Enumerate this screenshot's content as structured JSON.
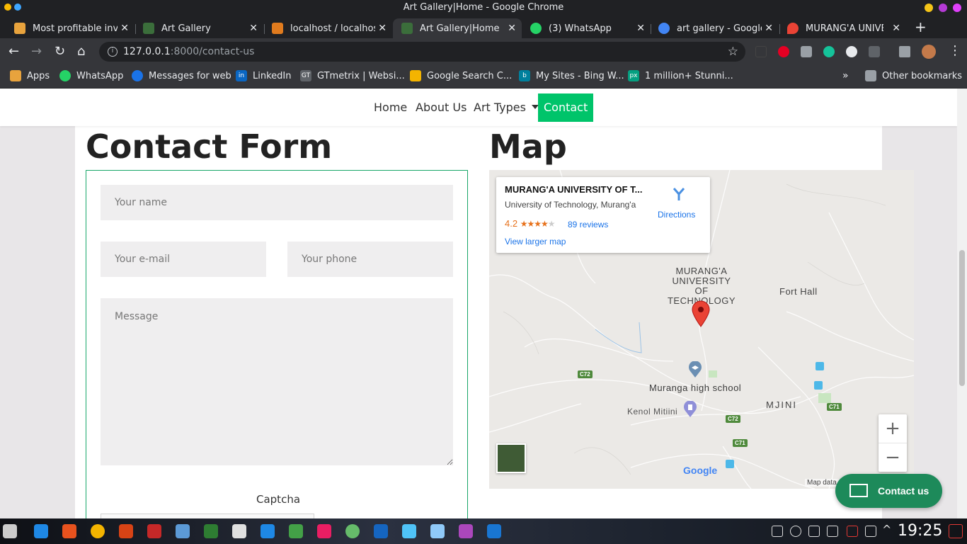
{
  "window": {
    "title": "Art Gallery|Home - Google Chrome"
  },
  "tabs": [
    {
      "label": "Most profitable inve",
      "color": "#e8a33d"
    },
    {
      "label": "Art Gallery",
      "color": "#3b6e3b"
    },
    {
      "label": "localhost / localhost",
      "color": "#e07b1e"
    },
    {
      "label": "Art Gallery|Home",
      "color": "#3b6e3b"
    },
    {
      "label": "(3) WhatsApp",
      "color": "#25d366"
    },
    {
      "label": "art gallery - Google",
      "color": "#4285f4"
    },
    {
      "label": "MURANG'A UNIVER",
      "color": "#ea4335"
    }
  ],
  "omnibox": {
    "host": "127.0.0.1",
    "path": ":8000/contact-us"
  },
  "bookmarks": [
    {
      "label": "Apps",
      "color": "#e8a33d"
    },
    {
      "label": "WhatsApp",
      "color": "#25d366"
    },
    {
      "label": "Messages for web",
      "color": "#1a73e8"
    },
    {
      "label": "LinkedIn",
      "color": "#0a66c2"
    },
    {
      "label": "GTmetrix | Websi...",
      "color": "#5f6368"
    },
    {
      "label": "Google Search C...",
      "color": "#f4b400"
    },
    {
      "label": "My Sites - Bing W...",
      "color": "#00809d"
    },
    {
      "label": "1 million+ Stunni...",
      "color": "#05a081"
    },
    {
      "label": "Other bookmarks",
      "color": "#9aa0a6"
    }
  ],
  "nav": {
    "home": "Home",
    "about": "About Us",
    "art_types": "Art Types",
    "contact": "Contact"
  },
  "contact_form": {
    "heading": "Contact Form",
    "name_placeholder": "Your name",
    "email_placeholder": "Your e-mail",
    "phone_placeholder": "Your phone",
    "message_placeholder": "Message",
    "captcha_label": "Captcha"
  },
  "map": {
    "heading": "Map",
    "place_name": "MURANG'A UNIVERSITY OF T...",
    "place_sub": "University of Technology, Murang'a",
    "rating": "4.2",
    "stars_on": "★★★★",
    "stars_off": "★",
    "reviews": "89 reviews",
    "larger_map": "View larger map",
    "directions": "Directions",
    "labels": {
      "university_1": "MURANG'A",
      "university_2": "UNIVERSITY",
      "university_3": "OF",
      "university_4": "TECHNOLOGY",
      "fort_hall": "Fort Hall",
      "school": "Muranga high school",
      "kenol": "Kenol Mitiini",
      "mjini": "MJINI"
    },
    "roads": [
      "C72",
      "C72",
      "C71",
      "C71"
    ],
    "zoom_in": "+",
    "zoom_out": "−",
    "map_data": "Map data",
    "google": "Google"
  },
  "contact_button": {
    "label": "Contact us"
  },
  "taskbar": {
    "clock": "19:25"
  }
}
